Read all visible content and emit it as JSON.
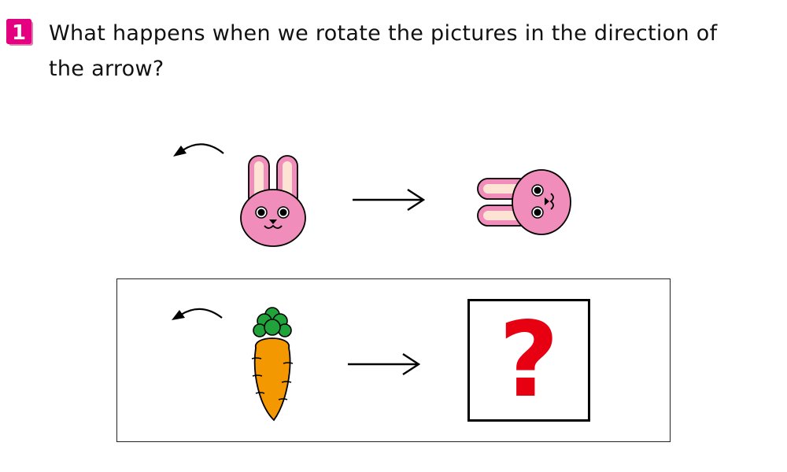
{
  "problem": {
    "number": "1",
    "question_line1": "What happens when we rotate the pictures in the direction of",
    "question_line2": "the arrow?",
    "answer_mark": "?"
  },
  "icons": {
    "rotate": "counterclockwise-arrow-icon",
    "maps_to": "right-arrow-icon",
    "example_before": "rabbit-upright-icon",
    "example_after": "rabbit-rotated-icon",
    "task_before": "carrot-icon"
  },
  "colors": {
    "badge": "#e4007f",
    "rabbit_face": "#f08dbb",
    "rabbit_inner_ear": "#fde3d3",
    "carrot": "#f39800",
    "carrot_leaves": "#1fa33a",
    "question_mark": "#e60012"
  }
}
